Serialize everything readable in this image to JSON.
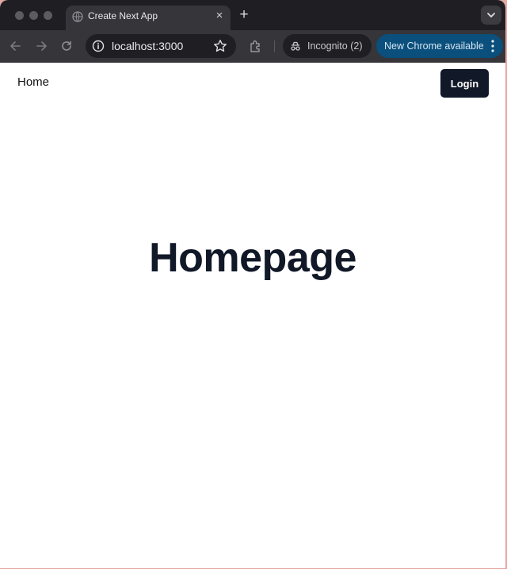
{
  "browser": {
    "tab": {
      "title": "Create Next App",
      "favicon": "globe-icon",
      "close": "×"
    },
    "new_tab": "+",
    "address": "localhost:3000",
    "incognito_label": "Incognito (2)",
    "update_label": "New Chrome available",
    "colors": {
      "frame": "#1f1f23",
      "toolbar": "#35353a",
      "update_pill": "#0b4f7c"
    }
  },
  "page": {
    "nav": {
      "home_label": "Home",
      "login_label": "Login"
    },
    "heading": "Homepage",
    "colors": {
      "button_bg": "#111827",
      "heading": "#111827"
    }
  }
}
